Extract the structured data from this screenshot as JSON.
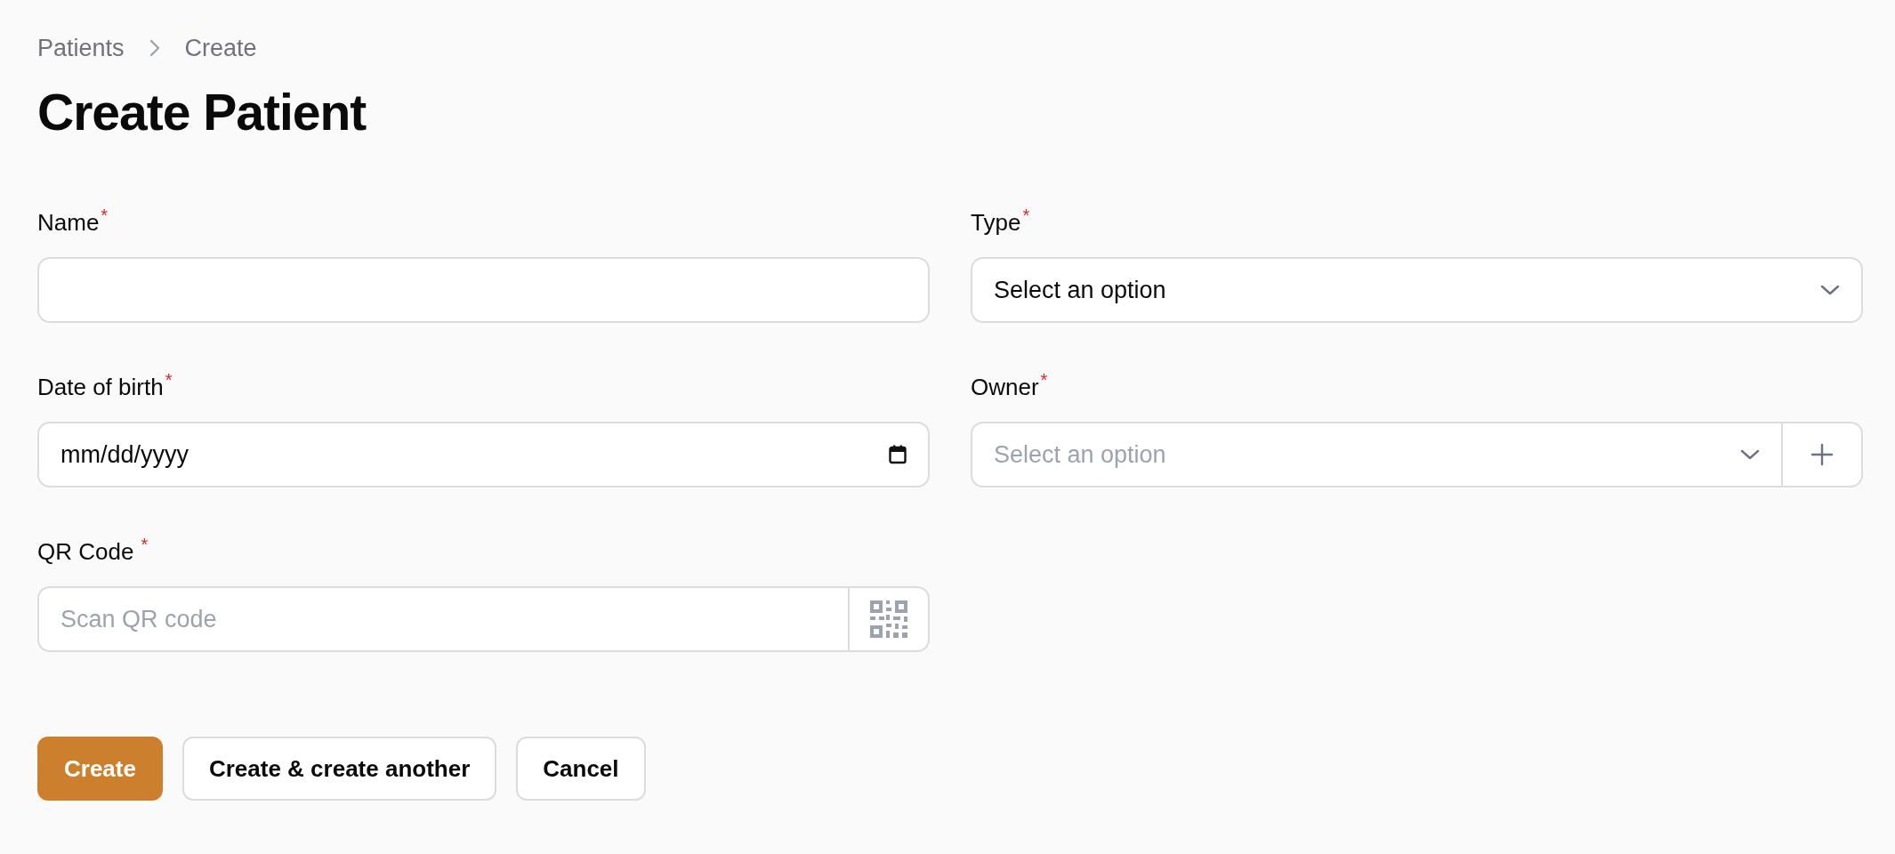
{
  "breadcrumbs": [
    "Patients",
    "Create"
  ],
  "title": "Create Patient",
  "fields": [
    {
      "kind": "text",
      "label": "Name",
      "required_mark": "*"
    },
    {
      "kind": "select",
      "label": "Type",
      "required_mark": "*",
      "value": "Select an option"
    },
    {
      "kind": "date",
      "label": "Date of birth",
      "required_mark": "*",
      "value": "mm/dd/yyyy"
    },
    {
      "kind": "select_add",
      "label": "Owner",
      "required_mark": "*",
      "placeholder": "Select an option"
    },
    {
      "kind": "qr",
      "label": "QR Code",
      "required_mark": "*",
      "placeholder": "Scan QR code"
    }
  ],
  "buttons": [
    {
      "kind": "primary",
      "label": "Create"
    },
    {
      "kind": "secondary",
      "label": "Create & create another"
    },
    {
      "kind": "secondary",
      "label": "Cancel"
    }
  ]
}
